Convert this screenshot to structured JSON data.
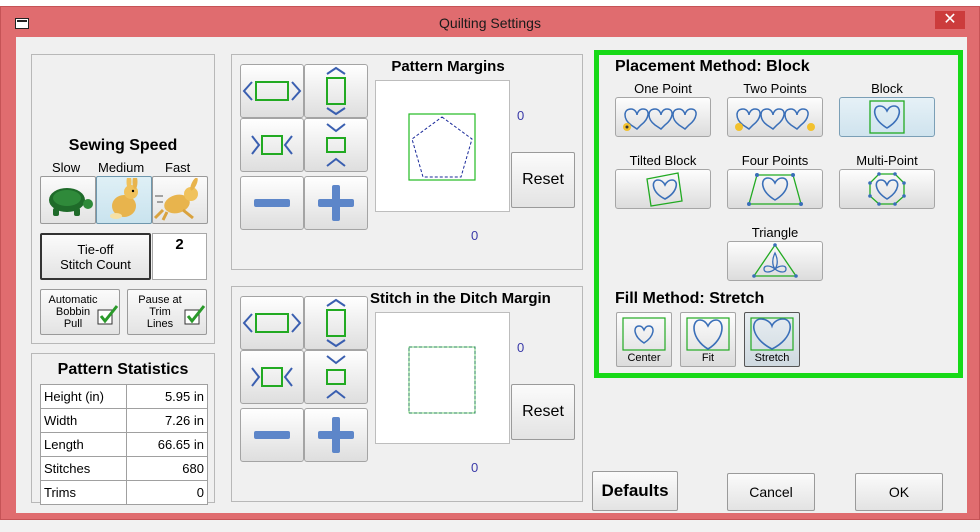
{
  "window": {
    "title": "Quilting Settings",
    "close_glyph": "✕",
    "accent_titlebar": "#e06c6f",
    "highlight_border": "#17d917"
  },
  "sewing_speed": {
    "heading": "Sewing Speed",
    "options": [
      {
        "label": "Slow",
        "icon": "turtle-icon"
      },
      {
        "label": "Medium",
        "icon": "rabbit-icon"
      },
      {
        "label": "Fast",
        "icon": "running-rabbit-icon"
      }
    ],
    "selected": "Medium"
  },
  "tieoff": {
    "label_line1": "Tie-off",
    "label_line2": "Stitch Count",
    "value": "2"
  },
  "automatic_bobbin_pull": {
    "line1": "Automatic",
    "line2": "Bobbin",
    "line3": "Pull",
    "checked": true
  },
  "pause_at_trim_lines": {
    "line1": "Pause at",
    "line2": "Trim",
    "line3": "Lines",
    "checked": true
  },
  "pattern_statistics": {
    "heading": "Pattern Statistics",
    "rows": [
      {
        "label": "Height (in)",
        "value": "5.95 in"
      },
      {
        "label": "Width",
        "value": "7.26 in"
      },
      {
        "label": "Length",
        "value": "66.65 in"
      },
      {
        "label": "Stitches",
        "value": "680"
      },
      {
        "label": "Trims",
        "value": "0"
      }
    ]
  },
  "pattern_margins": {
    "heading": "Pattern Margins",
    "right_value": "0",
    "bottom_value": "0",
    "reset_label": "Reset"
  },
  "ditch_margin": {
    "heading": "Stitch in the Ditch Margin",
    "right_value": "0",
    "bottom_value": "0",
    "reset_label": "Reset"
  },
  "placement": {
    "heading": "Placement Method: Block",
    "methods": [
      {
        "label": "One Point",
        "icon": "one-point-icon"
      },
      {
        "label": "Two Points",
        "icon": "two-points-icon"
      },
      {
        "label": "Block",
        "icon": "block-icon"
      },
      {
        "label": "Tilted Block",
        "icon": "tilted-block-icon"
      },
      {
        "label": "Four Points",
        "icon": "four-points-icon"
      },
      {
        "label": "Multi-Point",
        "icon": "multi-point-icon"
      },
      {
        "label": "Triangle",
        "icon": "triangle-icon"
      }
    ],
    "selected": "Block"
  },
  "fill": {
    "heading": "Fill Method: Stretch",
    "options": [
      {
        "label": "Center",
        "icon": "fill-center-icon"
      },
      {
        "label": "Fit",
        "icon": "fill-fit-icon"
      },
      {
        "label": "Stretch",
        "icon": "fill-stretch-icon"
      }
    ],
    "selected": "Stretch"
  },
  "footer": {
    "defaults_label": "Defaults",
    "cancel_label": "Cancel",
    "ok_label": "OK"
  }
}
